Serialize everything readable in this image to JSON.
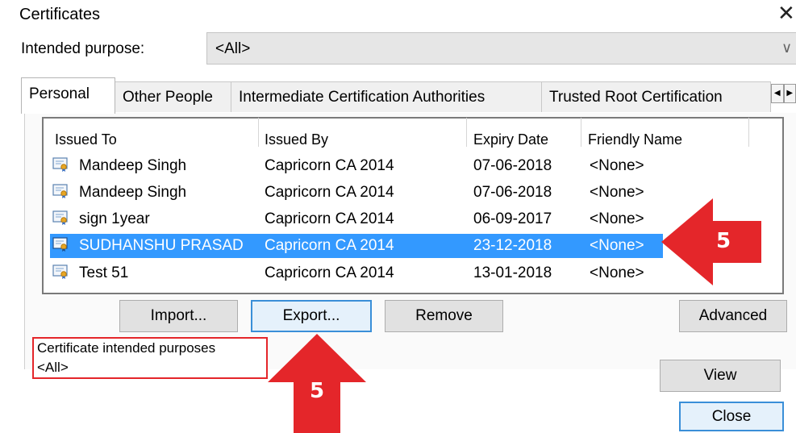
{
  "window": {
    "title": "Certificates",
    "close_glyph": "✕"
  },
  "purpose": {
    "label": "Intended purpose:",
    "value": "<All>"
  },
  "tabs": [
    {
      "label": "Personal",
      "active": true
    },
    {
      "label": "Other People",
      "active": false
    },
    {
      "label": "Intermediate Certification Authorities",
      "active": false
    },
    {
      "label": "Trusted Root Certification",
      "active": false
    }
  ],
  "tab_arrows": {
    "left": "◀",
    "right": "▶"
  },
  "list": {
    "columns": [
      "Issued To",
      "Issued By",
      "Expiry Date",
      "Friendly Name"
    ],
    "rows": [
      {
        "issued_to": "Mandeep Singh",
        "issued_by": "Capricorn CA 2014",
        "expiry": "07-06-2018",
        "friendly": "<None>",
        "selected": false
      },
      {
        "issued_to": "Mandeep Singh",
        "issued_by": "Capricorn CA 2014",
        "expiry": "07-06-2018",
        "friendly": "<None>",
        "selected": false
      },
      {
        "issued_to": "sign 1year",
        "issued_by": "Capricorn CA 2014",
        "expiry": "06-09-2017",
        "friendly": "<None>",
        "selected": false
      },
      {
        "issued_to": "SUDHANSHU PRASAD",
        "issued_by": "Capricorn CA 2014",
        "expiry": "23-12-2018",
        "friendly": "<None>",
        "selected": true
      },
      {
        "issued_to": "Test 51",
        "issued_by": "Capricorn CA 2014",
        "expiry": "13-01-2018",
        "friendly": "<None>",
        "selected": false
      }
    ]
  },
  "buttons": {
    "import": "Import...",
    "export": "Export...",
    "remove": "Remove",
    "advanced": "Advanced",
    "view": "View",
    "close": "Close"
  },
  "intended_purposes": {
    "title": "Certificate intended purposes",
    "value": "<All>"
  },
  "annotations": {
    "right_arrow_label": "5",
    "up_arrow_label": "5"
  },
  "colors": {
    "selection": "#3399ff",
    "annotation_red": "#e4262a",
    "focus_border": "#3a8fd8"
  },
  "icons": {
    "certificate": "certificate-icon"
  }
}
